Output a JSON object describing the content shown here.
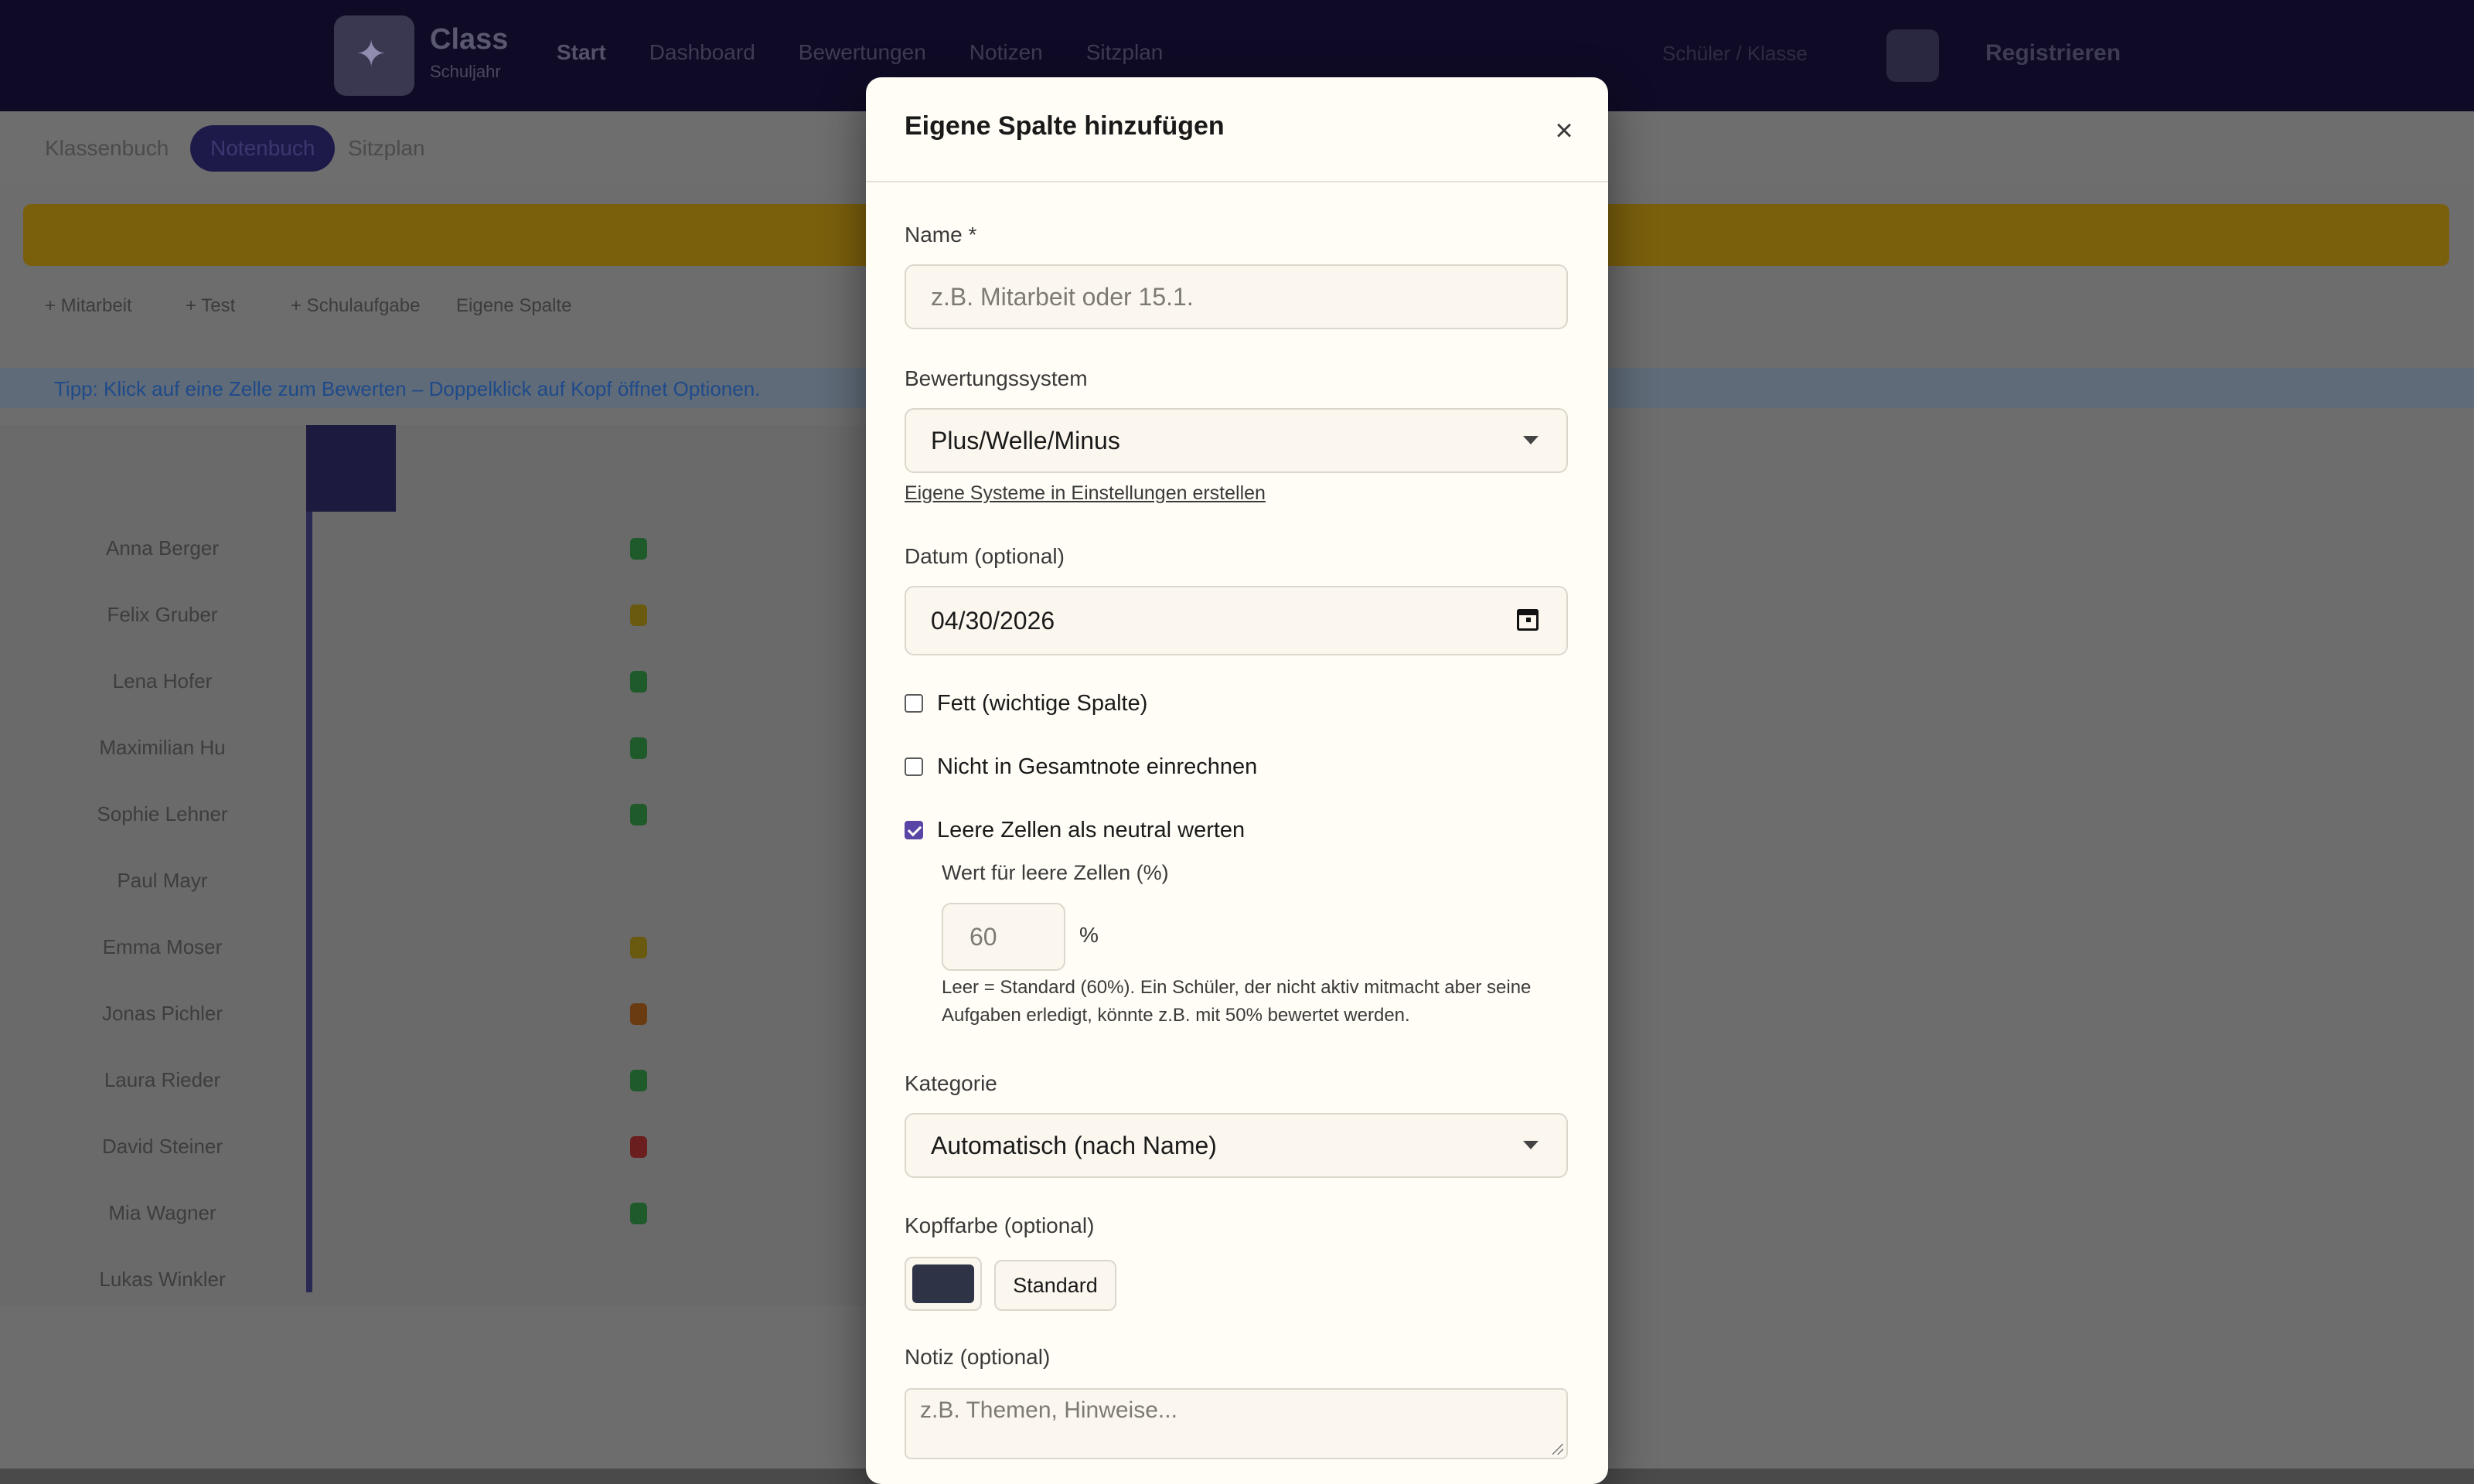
{
  "background": {
    "brand_name": "Class",
    "brand_sub": "Schuljahr",
    "top_nav": [
      "Start",
      "Dashboard",
      "Bewertungen",
      "Notizen",
      "Sitzplan"
    ],
    "top_search": "Schüler / Klasse",
    "top_right": "Registrieren",
    "sub_tabs": [
      "Klassenbuch",
      "Notenbuch",
      "Sitzplan"
    ],
    "toolbar": [
      "+ Mitarbeit",
      "+ Test",
      "+ Schulaufgabe",
      "Eigene Spalte"
    ],
    "info_text": "Tipp: Klick auf eine Zelle zum Bewerten – Doppelklick auf Kopf öffnet Optionen.",
    "students": [
      "Anna Berger",
      "Felix Gruber",
      "Lena Hofer",
      "Maximilian Hu",
      "Sophie Lehner",
      "Paul Mayr",
      "Emma Moser",
      "Jonas Pichler",
      "Laura Rieder",
      "David Steiner",
      "Mia Wagner",
      "Lukas Winkler"
    ]
  },
  "modal": {
    "title": "Eigene Spalte hinzufügen",
    "close_icon": "×",
    "name_label": "Name *",
    "name_placeholder": "z.B. Mitarbeit oder 15.1.",
    "system_label": "Bewertungssystem",
    "system_value": "Plus/Welle/Minus",
    "system_link": "Eigene Systeme in Einstellungen erstellen",
    "date_label": "Datum (optional)",
    "date_value": "04/30/2026",
    "cb_bold": "Fett (wichtige Spalte)",
    "cb_exclude": "Nicht in Gesamtnote einrechnen",
    "cb_neutral": "Leere Zellen als neutral werten",
    "cb_neutral_checked": true,
    "empty_value_label": "Wert für leere Zellen (%)",
    "empty_value": "60",
    "percent_sign": "%",
    "empty_hint": "Leer = Standard (60%). Ein Schüler, der nicht aktiv mitmacht aber seine Aufgaben erledigt, könnte z.B. mit 50% bewertet werden.",
    "category_label": "Kategorie",
    "category_value": "Automatisch (nach Name)",
    "header_color_label": "Kopffarbe (optional)",
    "header_color": "#2e3446",
    "standard_button": "Standard",
    "note_label": "Notiz (optional)",
    "note_placeholder": "z.B. Themen, Hinweise..."
  }
}
